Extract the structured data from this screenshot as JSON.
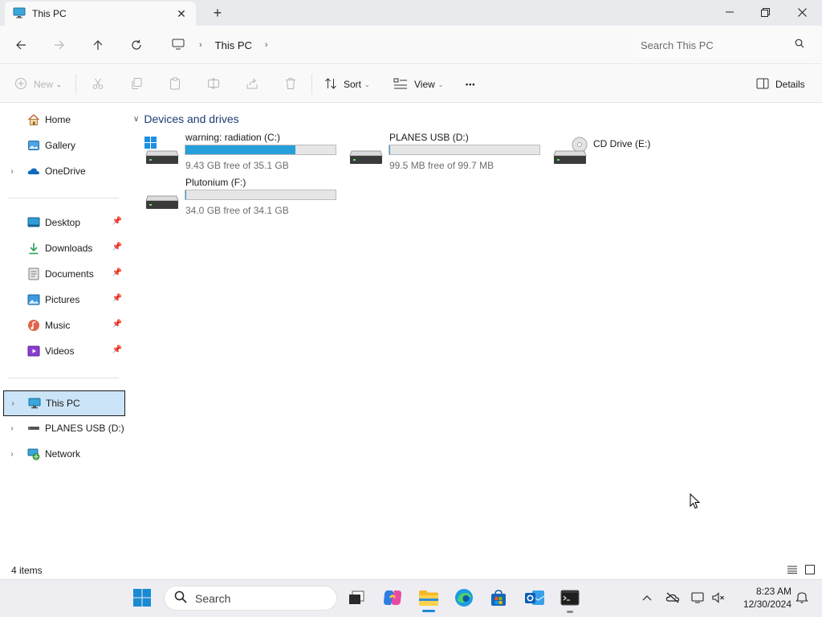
{
  "window": {
    "tab_title": "This PC",
    "tab_close": "✕",
    "new_tab": "+",
    "minimize": "—",
    "maximize": "❐",
    "close": "✕"
  },
  "nav": {
    "breadcrumb": [
      "This PC"
    ],
    "search_placeholder": "Search This PC"
  },
  "toolbar": {
    "new_label": "New",
    "sort_label": "Sort",
    "view_label": "View",
    "more_label": "•••",
    "details_label": "Details"
  },
  "sidebar": {
    "top_items": [
      {
        "label": "Home",
        "icon": "home-icon"
      },
      {
        "label": "Gallery",
        "icon": "gallery-icon"
      },
      {
        "label": "OneDrive",
        "icon": "onedrive-icon"
      }
    ],
    "pinned_items": [
      {
        "label": "Desktop",
        "icon": "desktop-icon"
      },
      {
        "label": "Downloads",
        "icon": "downloads-icon"
      },
      {
        "label": "Documents",
        "icon": "documents-icon"
      },
      {
        "label": "Pictures",
        "icon": "pictures-icon"
      },
      {
        "label": "Music",
        "icon": "music-icon"
      },
      {
        "label": "Videos",
        "icon": "videos-icon"
      }
    ],
    "bottom_items": [
      {
        "label": "This PC",
        "icon": "this-pc-icon",
        "selected": true
      },
      {
        "label": "PLANES USB (D:)",
        "icon": "usb-drive-icon"
      },
      {
        "label": "Network",
        "icon": "network-icon"
      }
    ]
  },
  "content": {
    "group_title": "Devices and drives",
    "drives": [
      {
        "name": "warning: radiation (C:)",
        "free_text": "9.43 GB free of 35.1 GB",
        "used_fraction": 0.731
      },
      {
        "name": "PLANES USB (D:)",
        "free_text": "99.5 MB free of 99.7 MB",
        "used_fraction": 0.002
      },
      {
        "name": "CD Drive (E:)"
      },
      {
        "name": "Plutonium (F:)",
        "free_text": "34.0 GB free of 34.1 GB",
        "used_fraction": 0.003
      }
    ]
  },
  "status": {
    "item_count": "4 items"
  },
  "taskbar": {
    "search_label": "Search",
    "time": "8:23 AM",
    "date": "12/30/2024"
  },
  "colors": {
    "accent": "#26a0da",
    "selection": "#cce4f7",
    "header_blue": "#1f3b73"
  }
}
